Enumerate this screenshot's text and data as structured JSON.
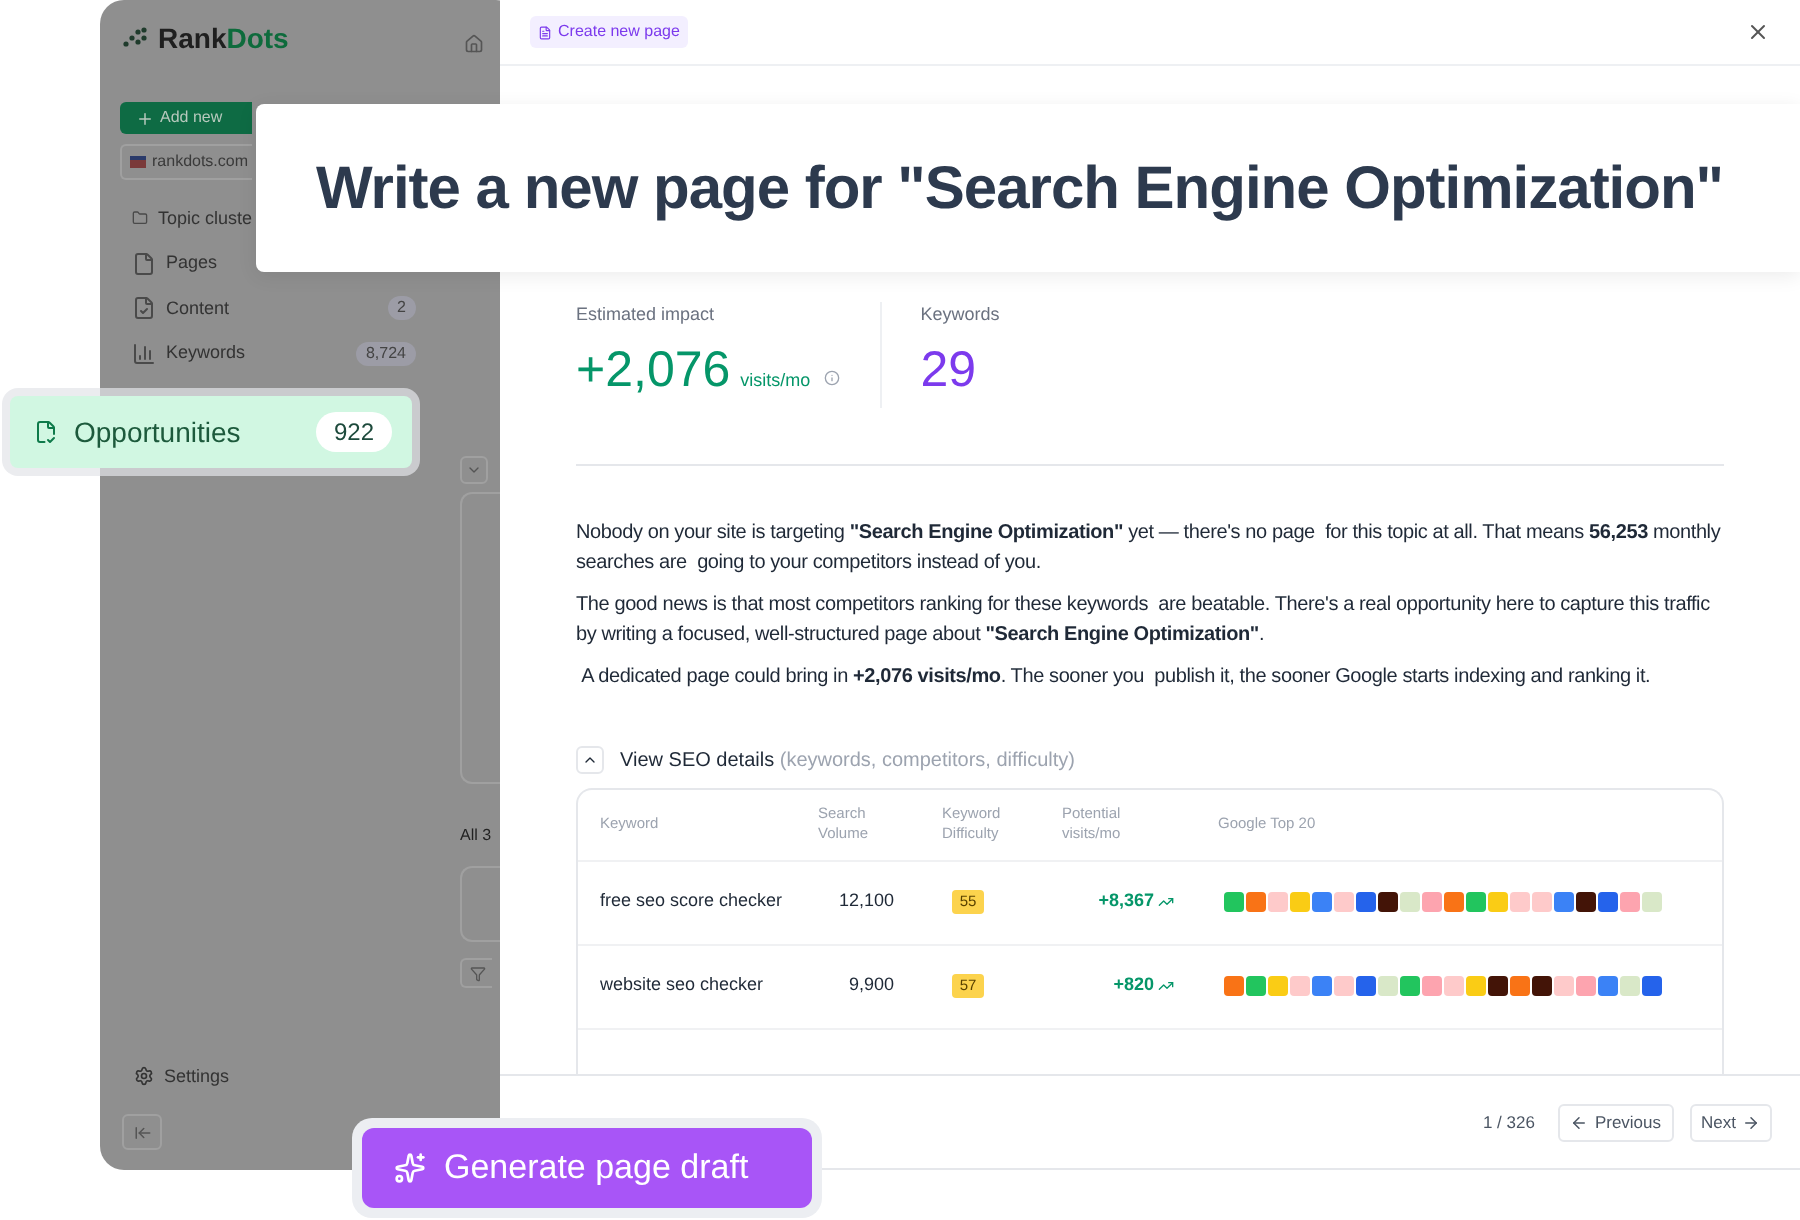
{
  "app": {
    "logo_prefix": "Rank",
    "logo_suffix": "Dots",
    "add_button": "Add new",
    "site": "rankdots.com",
    "nav": [
      {
        "kind": "folder",
        "label": "Topic cluste"
      },
      {
        "kind": "page",
        "label": "Pages"
      },
      {
        "kind": "content",
        "label": "Content",
        "count": "2"
      },
      {
        "kind": "chart",
        "label": "Keywords",
        "count": "8,724"
      }
    ],
    "list_heading": "All 3",
    "settings": "Settings"
  },
  "highlight": {
    "label": "Opportunities",
    "count": "922"
  },
  "modal": {
    "badge": "Create new page",
    "title": "Write a new page for \"Search Engine Optimization\"",
    "stats": [
      {
        "label": "Estimated impact",
        "value": "+2,076",
        "unit": "visits/mo",
        "kind": "impact"
      },
      {
        "label": "Keywords",
        "value": "29",
        "kind": "count"
      }
    ],
    "paragraphs": [
      "Nobody on your site is targeting **\"Search Engine Optimization\"** yet — there's no page  for this topic at all. That means **56,253** monthly searches are  going to your competitors instead of you.",
      "The good news is that most competitors ranking for these keywords  are beatable. There's a real opportunity here to capture this traffic  by writing a focused, well-structured page about **\"Search Engine Optimization\"**.",
      " A dedicated page could bring in **+2,076 visits/mo**. The sooner you  publish it, the sooner Google starts indexing and ranking it."
    ],
    "details": {
      "label": "View SEO details",
      "hint": "(keywords, competitors, difficulty)",
      "expanded": true
    },
    "table": {
      "columns": [
        "Keyword",
        "Search Volume",
        "Keyword Difficulty",
        "Potential visits/mo",
        "Google Top 20"
      ],
      "rows": [
        {
          "keyword": "free seo score checker",
          "volume": "12,100",
          "difficulty": "55",
          "potential": "+8,367",
          "top20": [
            {
              "color": "#22c55e"
            },
            {
              "color": "#f97316"
            },
            {
              "color": "#fecaca"
            },
            {
              "color": "#facc15"
            },
            {
              "color": "#3b82f6"
            },
            {
              "color": "#fecaca"
            },
            {
              "color": "#2563eb"
            },
            {
              "color": "#431407"
            },
            {
              "color": "#d9e8c8"
            },
            {
              "color": "#fda4af"
            },
            {
              "color": "#f97316"
            },
            {
              "color": "#22c55e"
            },
            {
              "color": "#facc15"
            },
            {
              "color": "#fecaca"
            },
            {
              "color": "#fecaca"
            },
            {
              "color": "#3b82f6"
            },
            {
              "color": "#431407"
            },
            {
              "color": "#2563eb"
            },
            {
              "color": "#fda4af"
            },
            {
              "color": "#d9e8c8"
            }
          ]
        },
        {
          "keyword": "website seo checker",
          "volume": "9,900",
          "difficulty": "57",
          "potential": "+820",
          "top20": [
            {
              "color": "#f97316"
            },
            {
              "color": "#22c55e"
            },
            {
              "color": "#facc15"
            },
            {
              "color": "#fecaca"
            },
            {
              "color": "#3b82f6"
            },
            {
              "color": "#fecaca"
            },
            {
              "color": "#2563eb"
            },
            {
              "color": "#d9e8c8"
            },
            {
              "color": "#22c55e"
            },
            {
              "color": "#fda4af"
            },
            {
              "color": "#fecaca"
            },
            {
              "color": "#facc15"
            },
            {
              "color": "#431407"
            },
            {
              "color": "#f97316"
            },
            {
              "color": "#431407"
            },
            {
              "color": "#fecaca"
            },
            {
              "color": "#fda4af"
            },
            {
              "color": "#3b82f6"
            },
            {
              "color": "#d9e8c8"
            },
            {
              "color": "#2563eb"
            }
          ]
        }
      ]
    },
    "pager": {
      "position": "1 / 326",
      "previous": "Previous",
      "next": "Next"
    },
    "generate": "Generate page draft"
  }
}
